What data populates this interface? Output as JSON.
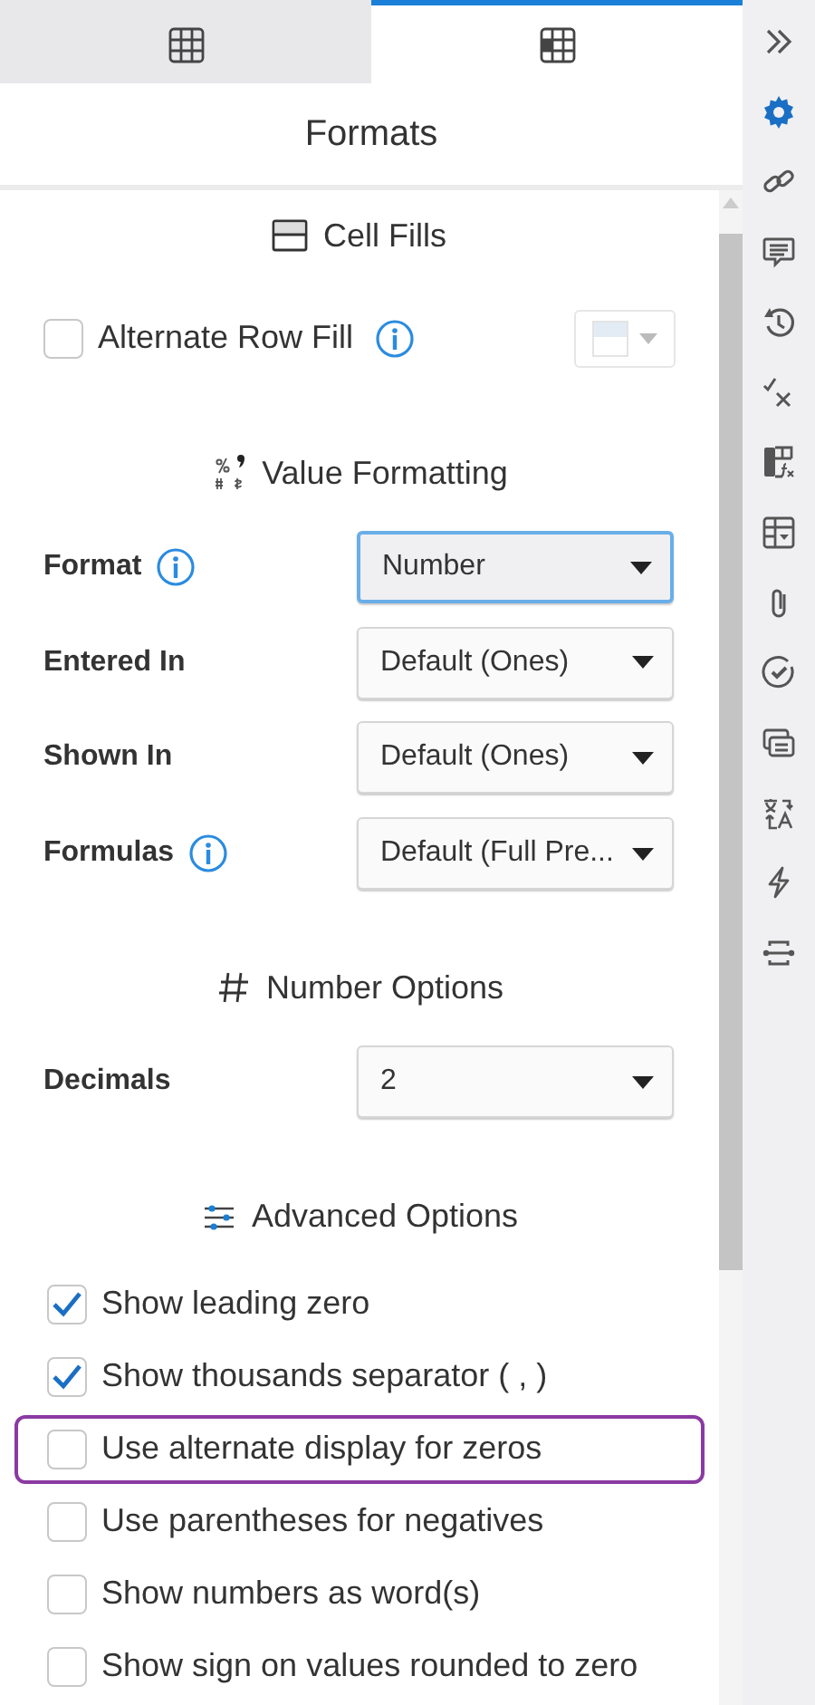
{
  "tabs": [
    {
      "kind": "grid",
      "selected": false
    },
    {
      "kind": "gridfill",
      "selected": true
    }
  ],
  "title": "Formats",
  "cell_fills": {
    "heading": "Cell Fills",
    "alternate_row_fill": {
      "label": "Alternate Row Fill",
      "checked": false,
      "info": true
    }
  },
  "value_formatting": {
    "heading": "Value Formatting",
    "fields": [
      {
        "label": "Format",
        "info": true,
        "value": "Number",
        "focused": true
      },
      {
        "label": "Entered In",
        "info": false,
        "value": "Default (Ones)",
        "focused": false
      },
      {
        "label": "Shown In",
        "info": false,
        "value": "Default (Ones)",
        "focused": false
      },
      {
        "label": "Formulas",
        "info": true,
        "value": "Default (Full Pre...",
        "focused": false
      }
    ]
  },
  "number_options": {
    "heading": "Number Options",
    "fields": [
      {
        "label": "Decimals",
        "info": false,
        "value": "2",
        "focused": false
      }
    ]
  },
  "advanced_options": {
    "heading": "Advanced Options",
    "options": [
      {
        "label": "Show leading zero",
        "checked": true,
        "highlighted": false
      },
      {
        "label": "Show thousands separator ( , )",
        "checked": true,
        "highlighted": false
      },
      {
        "label": "Use alternate display for zeros",
        "checked": false,
        "highlighted": true
      },
      {
        "label": "Use parentheses for negatives",
        "checked": false,
        "highlighted": false
      },
      {
        "label": "Show numbers as word(s)",
        "checked": false,
        "highlighted": false
      },
      {
        "label": "Show sign on values rounded to zero",
        "checked": false,
        "highlighted": false
      }
    ]
  },
  "rail": [
    {
      "kind": "collapse",
      "selected": false
    },
    {
      "kind": "settings",
      "selected": true
    },
    {
      "kind": "link",
      "selected": false
    },
    {
      "kind": "comment",
      "selected": false
    },
    {
      "kind": "history",
      "selected": false
    },
    {
      "kind": "checkx",
      "selected": false
    },
    {
      "kind": "formula",
      "selected": false
    },
    {
      "kind": "tabledrop",
      "selected": false
    },
    {
      "kind": "attach",
      "selected": false
    },
    {
      "kind": "approve",
      "selected": false
    },
    {
      "kind": "cards",
      "selected": false
    },
    {
      "kind": "translate",
      "selected": false
    },
    {
      "kind": "bolt",
      "selected": false
    },
    {
      "kind": "connector",
      "selected": false
    }
  ]
}
